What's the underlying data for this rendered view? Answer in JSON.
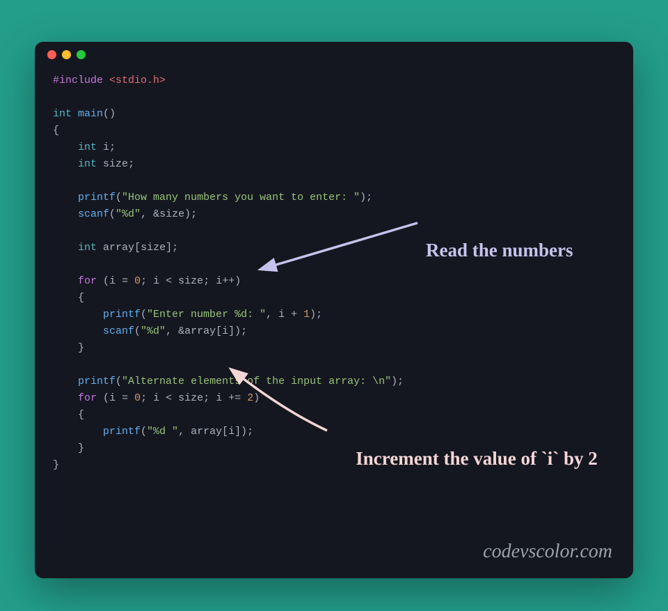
{
  "window": {
    "dots": [
      "close",
      "minimize",
      "zoom"
    ]
  },
  "code": {
    "l1_include": "#include",
    "l1_header": "<stdio.h>",
    "kw_int": "int",
    "main": "main",
    "ob": "(",
    "cb": ")",
    "oc": "{",
    "cc": "}",
    "semi": ";",
    "i": "i",
    "size": "size",
    "printf": "printf",
    "scanf": "scanf",
    "s_prompt": "\"How many numbers you want to enter: \"",
    "fmt_d": "\"%d\"",
    "amp": "&",
    "comma": ", ",
    "array": "array",
    "lb": "[",
    "rb": "]",
    "kw_for": "for",
    "eq": " = ",
    "n0": "0",
    "lt": " < ",
    "inc": "++",
    "s_enter": "\"Enter number %d: \"",
    "plus": " + ",
    "n1": "1",
    "s_alt": "\"Alternate elements of the input array: \\n\"",
    "pluseq": " += ",
    "n2": "2",
    "fmt_ds": "\"%d \""
  },
  "annotation1": "Read the numbers",
  "annotation2": "Increment the value of `i` by 2",
  "watermark": "codevscolor.com"
}
